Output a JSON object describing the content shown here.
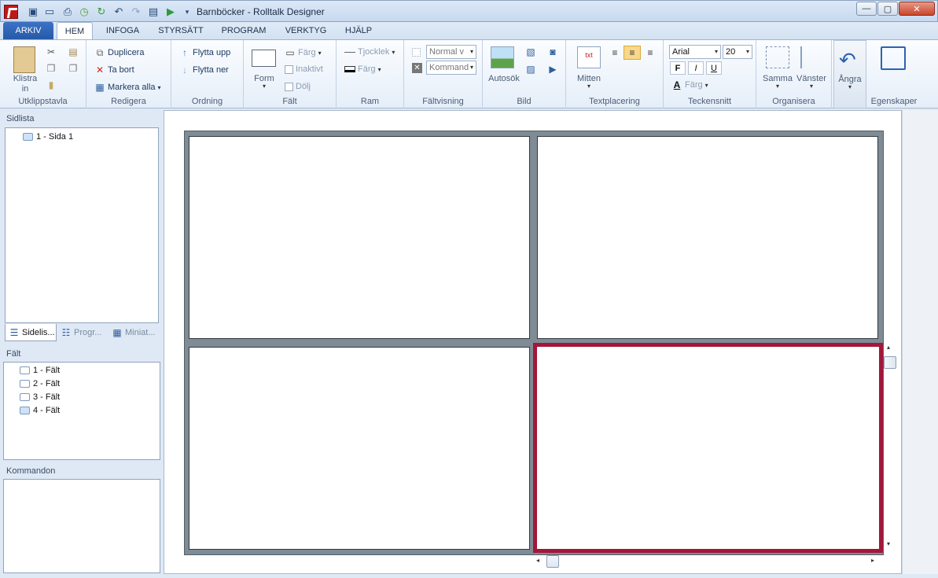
{
  "window": {
    "title": "Barnböcker - Rolltalk Designer",
    "controls": {
      "minimize": "—",
      "maximize": "▢",
      "close": "✕"
    }
  },
  "quick_access": [
    "save-icon",
    "open-folder-icon",
    "print-icon",
    "history-icon",
    "refresh-icon",
    "undo-icon",
    "redo-icon",
    "preview-icon",
    "play-icon",
    "customize-icon"
  ],
  "tabs": [
    "ARKIV",
    "HEM",
    "INFOGA",
    "STYRSÄTT",
    "PROGRAM",
    "VERKTYG",
    "HJÄLP"
  ],
  "ribbon": {
    "clipboard": {
      "paste": "Klistra",
      "paste2": "in",
      "label": "Utklippstavla"
    },
    "edit": {
      "duplicate": "Duplicera",
      "delete": "Ta bort",
      "select_all": "Markera alla",
      "label": "Redigera"
    },
    "order": {
      "move_up": "Flytta upp",
      "move_down": "Flytta ner",
      "label": "Ordning"
    },
    "field": {
      "form": "Form",
      "color": "Färg",
      "inactive": "Inaktivt",
      "hide": "Dölj",
      "label": "Fält"
    },
    "frame": {
      "thickness": "Tjocklek",
      "color": "Färg",
      "label": "Ram"
    },
    "field_view": {
      "normal": "Normal v",
      "command": "Kommand",
      "label": "Fältvisning"
    },
    "image": {
      "autosearch": "Autosök",
      "label": "Bild"
    },
    "text_place": {
      "center": "Mitten",
      "txt_icon": "txt",
      "label": "Textplacering"
    },
    "font": {
      "family": "Arial",
      "size": "20",
      "bold": "F",
      "italic": "I",
      "underline": "U",
      "color": "Färg",
      "label": "Teckensnitt"
    },
    "arrange": {
      "same": "Samma",
      "left": "Vänster",
      "label": "Organisera"
    },
    "undo": {
      "label": "Ångra"
    },
    "properties": {
      "label": "Egenskaper"
    }
  },
  "page_list": {
    "title": "Sidlista",
    "items": [
      "1 - Sida 1"
    ],
    "tabs": [
      "Sidelis...",
      "Progr...",
      "Miniat..."
    ]
  },
  "fields": {
    "title": "Fält",
    "items": [
      "1 - Fält",
      "2 - Fält",
      "3 - Fält",
      "4 - Fält"
    ]
  },
  "commands": {
    "title": "Kommandon"
  }
}
